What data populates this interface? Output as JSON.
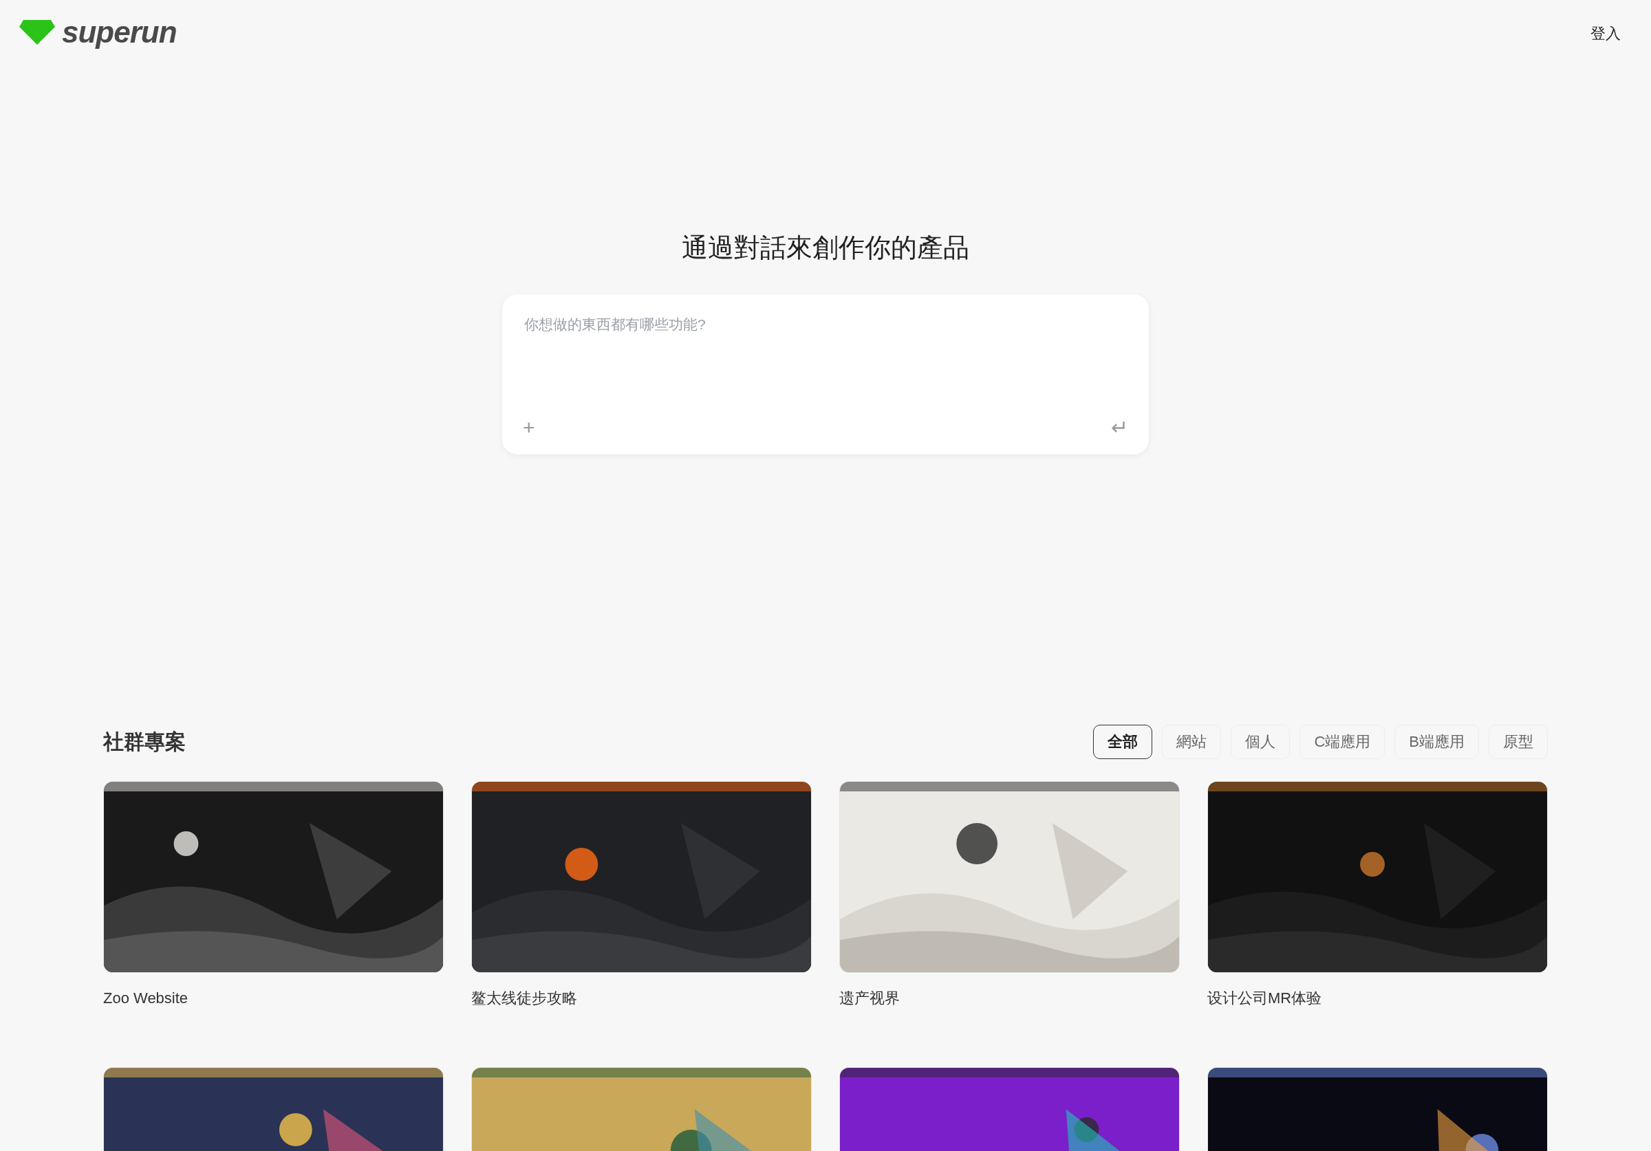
{
  "header": {
    "logo": "superun",
    "login": "登入"
  },
  "hero": {
    "title": "通過對話來創作你的產品",
    "prompt": {
      "placeholder": "你想做的東西都有哪些功能?",
      "attach": "+",
      "submit": "↵"
    }
  },
  "community": {
    "title": "社群專案",
    "filters": [
      {
        "label": "全部",
        "selected": true
      },
      {
        "label": "網站",
        "selected": false
      },
      {
        "label": "個人",
        "selected": false
      },
      {
        "label": "C端應用",
        "selected": false
      },
      {
        "label": "B端應用",
        "selected": false
      },
      {
        "label": "原型",
        "selected": false
      }
    ],
    "projects": [
      {
        "name": "Zoo Website",
        "kind": "picture"
      },
      {
        "name": "鳌太线徒步攻略",
        "kind": "picture"
      },
      {
        "name": "遗产视界",
        "kind": "picture"
      },
      {
        "name": "设计公司MR体验",
        "kind": "picture"
      },
      {
        "kind": "picture"
      },
      {
        "kind": "picture"
      },
      {
        "kind": "picture"
      },
      {
        "kind": "picture"
      }
    ]
  }
}
